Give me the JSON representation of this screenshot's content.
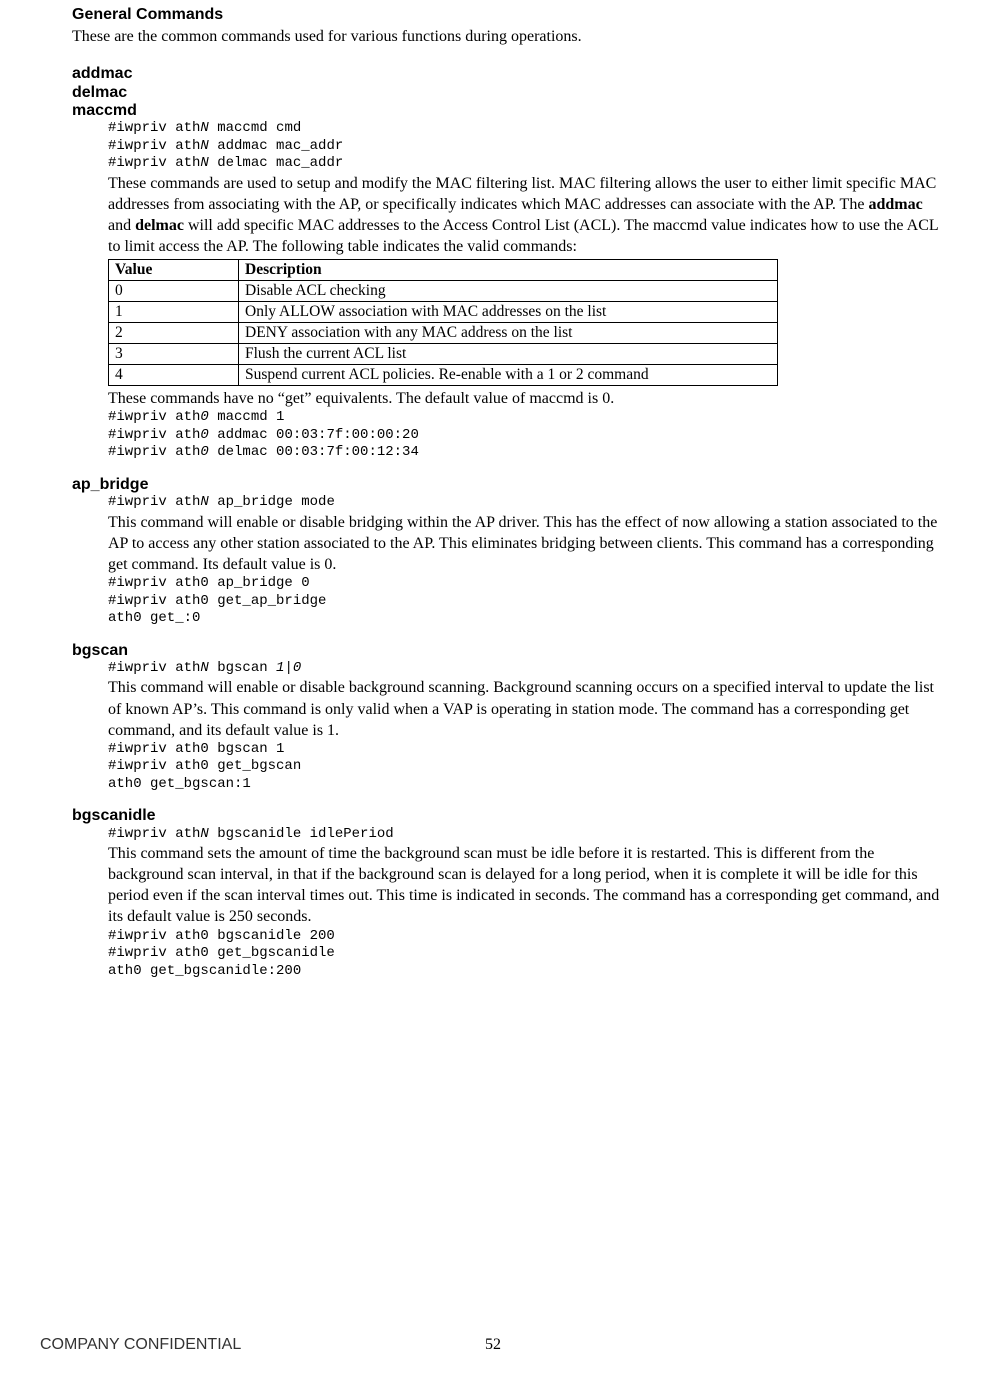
{
  "section": {
    "title": "General Commands",
    "intro": "These are the common commands used for various functions during operations."
  },
  "mac": {
    "names": [
      "addmac",
      "delmac",
      "maccmd"
    ],
    "syntax_pre1": "#iwpriv ath",
    "syntax_N": "N",
    "syntax_line1_rest": " maccmd cmd",
    "syntax_line2_rest": " addmac mac_addr",
    "syntax_line3_rest": " delmac mac_addr",
    "desc_a": "These commands are used to setup and modify the MAC filtering list. MAC filtering allows the user to either limit specific MAC addresses from associating with the AP, or specifically indicates which MAC addresses can associate with the AP. The ",
    "desc_bold1": "addmac",
    "desc_b": " and ",
    "desc_bold2": "delmac",
    "desc_c": " will add specific MAC addresses to the Access Control List (ACL). The maccmd value indicates how to use the ACL to limit access the AP. The following table indicates the valid commands:",
    "table": {
      "headers": [
        "Value",
        "Description"
      ],
      "rows": [
        [
          "0",
          "Disable ACL checking"
        ],
        [
          "1",
          "Only ALLOW association with MAC addresses on the list"
        ],
        [
          "2",
          "DENY association with any MAC address on the list"
        ],
        [
          "3",
          "Flush the current ACL list"
        ],
        [
          "4",
          "Suspend current ACL policies. Re-enable with a 1 or 2 command"
        ]
      ]
    },
    "after_table": "These commands have no “get” equivalents. The default value of maccmd is 0.",
    "ex_pre": "#iwpriv ath",
    "ex_zero": "0",
    "ex_line1_rest": " maccmd 1",
    "ex_line2_rest": " addmac 00:03:7f:00:00:20",
    "ex_line3_rest": " delmac 00:03:7f:00:12:34"
  },
  "apbridge": {
    "name": "ap_bridge",
    "syntax_rest": " ap_bridge mode",
    "desc": "This command will enable or disable bridging within the AP driver. This has the effect of now allowing a station associated to the AP to access any other station associated to the AP. This eliminates bridging between clients. This command has a corresponding get command. Its default value is 0.",
    "example": "#iwpriv ath0 ap_bridge 0\n#iwpriv ath0 get_ap_bridge\nath0 get_:0"
  },
  "bgscan": {
    "name": "bgscan",
    "syntax_rest_a": " bgscan ",
    "syntax_rest_b": "1|0",
    "desc": "This command will enable or disable background scanning. Background scanning occurs on a specified interval to update the list of known AP’s. This command is only valid when a VAP is operating in station mode. The command has a corresponding get command, and its default value is 1.",
    "example": "#iwpriv ath0 bgscan 1\n#iwpriv ath0 get_bgscan\nath0 get_bgscan:1"
  },
  "bgscanidle": {
    "name": "bgscanidle",
    "syntax_rest": " bgscanidle idlePeriod",
    "desc": "This command sets the amount of time the background scan must be idle before it is restarted. This is different from the background scan interval, in that if the background scan is delayed for a long period, when it is complete it will be idle for this period even if the scan interval times out. This time is indicated in seconds. The command has a corresponding get command, and its default value is 250 seconds.",
    "example": "#iwpriv ath0 bgscanidle 200\n#iwpriv ath0 get_bgscanidle\nath0 get_bgscanidle:200"
  },
  "footer": {
    "confidential": "COMPANY CONFIDENTIAL",
    "page": "52"
  }
}
